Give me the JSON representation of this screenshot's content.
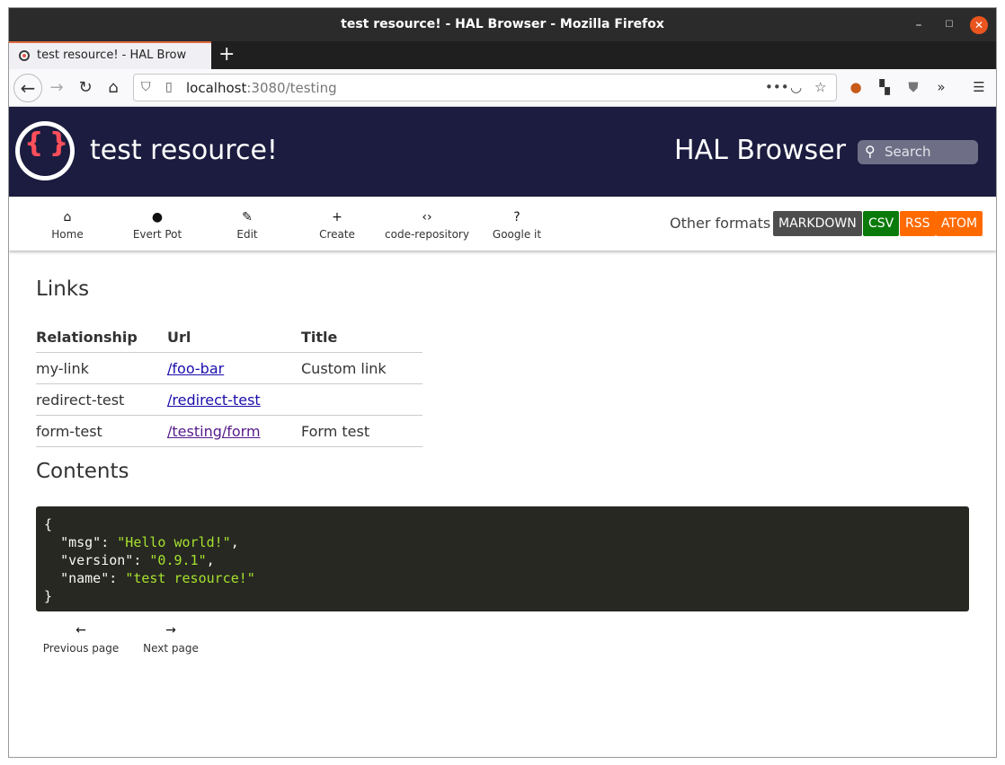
{
  "window": {
    "title": "test resource! - HAL Browser - Mozilla Firefox"
  },
  "tab": {
    "title": "test resource! - HAL Brow",
    "new_tab": "+"
  },
  "navbar": {
    "url_host": "localhost",
    "url_rest": ":3080/testing"
  },
  "header": {
    "logo_mark": "{ }",
    "page_title": "test resource!",
    "brand": "HAL Browser",
    "search_placeholder": "Search"
  },
  "nav": {
    "items": [
      {
        "icon": "home-icon",
        "glyph": "⌂",
        "label": "Home"
      },
      {
        "icon": "person-icon",
        "glyph": "●",
        "label": "Evert Pot"
      },
      {
        "icon": "pencil-icon",
        "glyph": "✎",
        "label": "Edit"
      },
      {
        "icon": "plus-icon",
        "glyph": "+",
        "label": "Create"
      },
      {
        "icon": "code-icon",
        "glyph": "‹›",
        "label": "code-repository"
      },
      {
        "icon": "help-icon",
        "glyph": "?",
        "label": "Google it"
      }
    ],
    "other_formats_label": "Other formats",
    "formats": [
      {
        "label": "MARKDOWN",
        "color": "#4d4d4d"
      },
      {
        "label": "CSV",
        "color": "#0a7a0a"
      },
      {
        "label": "RSS",
        "color": "#ff6a00"
      },
      {
        "label": "ATOM",
        "color": "#ff6a00"
      }
    ]
  },
  "links": {
    "heading": "Links",
    "columns": [
      "Relationship",
      "Url",
      "Title"
    ],
    "rows": [
      {
        "rel": "my-link",
        "url": "/foo-bar",
        "title": "Custom link"
      },
      {
        "rel": "redirect-test",
        "url": "/redirect-test",
        "title": ""
      },
      {
        "rel": "form-test",
        "url": "/testing/form",
        "title": "Form test"
      }
    ]
  },
  "contents": {
    "heading": "Contents",
    "json": {
      "open": "{",
      "msg_key": "\"msg\"",
      "msg_val": "\"Hello world!\"",
      "version_key": "\"version\"",
      "version_val": "\"0.9.1\"",
      "name_key": "\"name\"",
      "name_val": "\"test resource!\"",
      "close": "}"
    }
  },
  "pager": {
    "prev_label": "Previous page",
    "next_label": "Next page"
  },
  "colors": {
    "header_bg": "#1b1c3f",
    "logo_accent": "#ff4f5a",
    "code_bg": "#272822",
    "code_string": "#a6e22e"
  }
}
